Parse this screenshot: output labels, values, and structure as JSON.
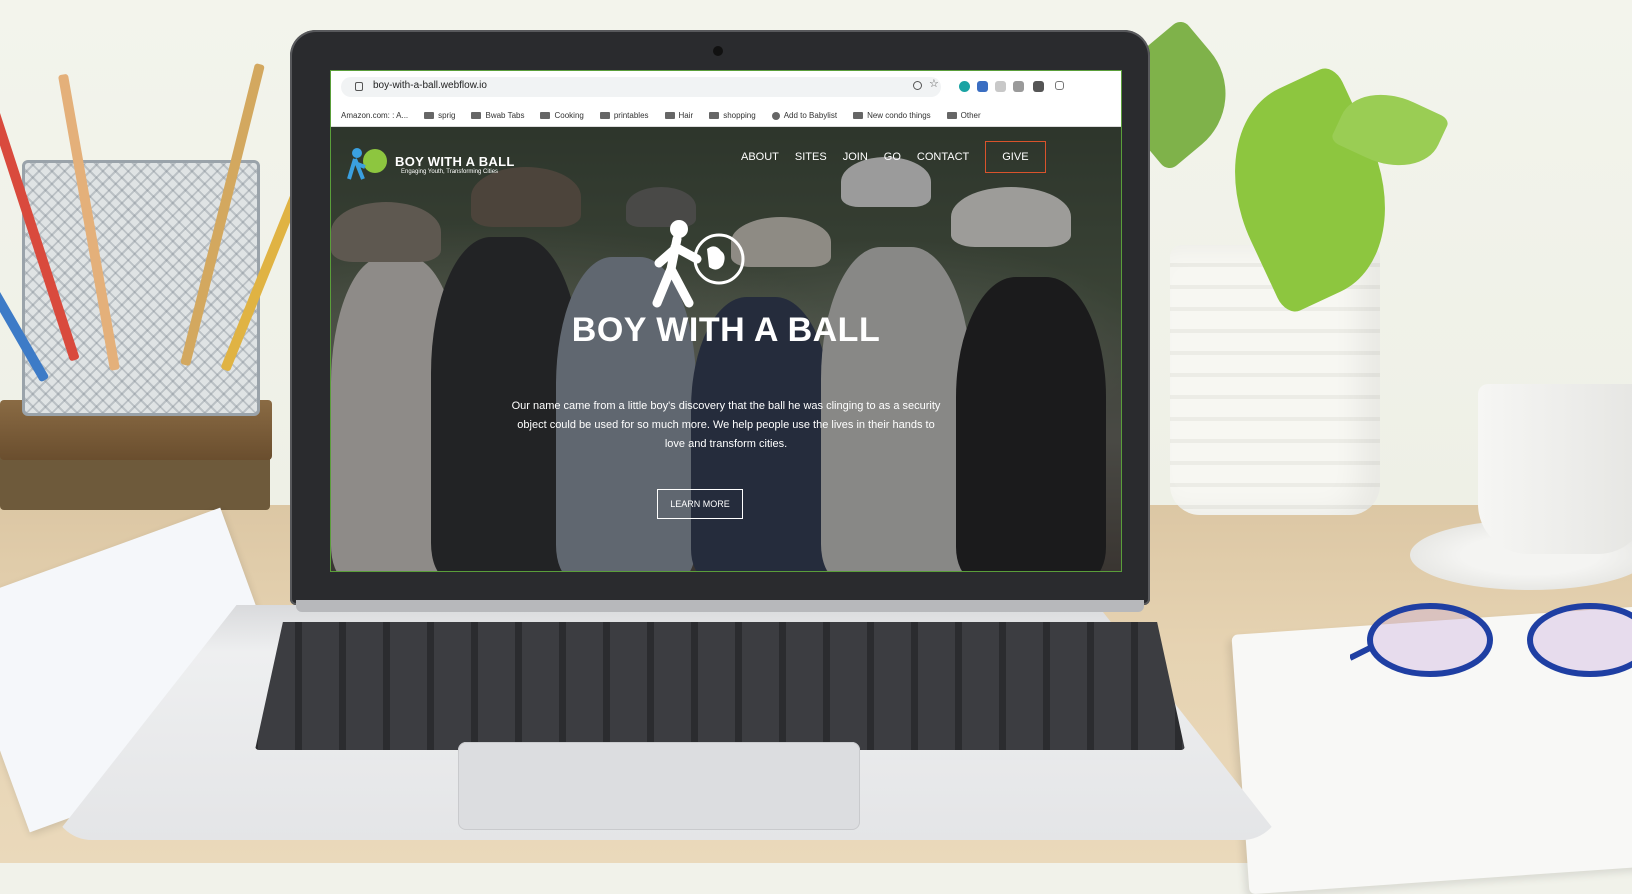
{
  "browser": {
    "url": "boy-with-a-ball.webflow.io",
    "bookmarks": [
      "Amazon.com: : A...",
      "sprig",
      "Bwab Tabs",
      "Cooking",
      "printables",
      "Hair",
      "shopping",
      "Add to Babylist",
      "New condo things",
      "Other"
    ]
  },
  "site": {
    "brand": "BOY WITH A BALL",
    "tagline": "Engaging Youth, Transforming Cities",
    "nav": [
      "ABOUT",
      "SITES",
      "JOIN",
      "GO",
      "CONTACT"
    ],
    "give_label": "GIVE",
    "hero_title": "BOY WITH A BALL",
    "hero_text": "Our name came from a little boy's discovery that the ball he was clinging to as a security object could be used for so much more. We help people use the lives in their hands to love and transform cities.",
    "cta_label": "LEARN MORE",
    "accent_color": "#d9532c"
  }
}
